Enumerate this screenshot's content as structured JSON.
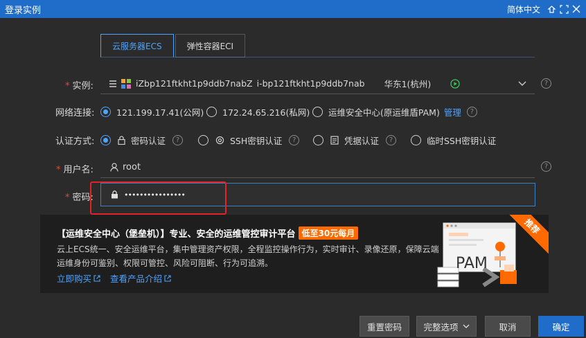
{
  "window": {
    "title": "登录实例",
    "language": "简体中文"
  },
  "tabs": [
    {
      "label": "云服务器ECS"
    },
    {
      "label": "弹性容器ECI"
    }
  ],
  "instance": {
    "label": "实例:",
    "id": "iZbp121ftkht1p9ddb7nabZ",
    "instance_id": "i-bp121ftkht1p9ddb7nab",
    "region": "华东1(杭州)"
  },
  "network": {
    "label": "网络连接:",
    "options": [
      {
        "label": "121.199.17.41(公网)"
      },
      {
        "label": "172.24.65.216(私网)"
      },
      {
        "label": "运维安全中心(原运维盾PAM)"
      }
    ],
    "manage_link": "管理"
  },
  "auth": {
    "label": "认证方式:",
    "options": [
      {
        "label": "密码认证"
      },
      {
        "label": "SSH密钥认证"
      },
      {
        "label": "凭据认证"
      },
      {
        "label": "临时SSH密钥认证"
      }
    ]
  },
  "username": {
    "label": "用户名:",
    "value": "root"
  },
  "password": {
    "label": "密码:",
    "value": "••••••••••••••••"
  },
  "banner": {
    "title": "【运维安全中心（堡垒机）】专业、安全的运维管控审计平台",
    "badge": "低至30元每月",
    "desc": "云上ECS统一、安全运维平台，集中管理资产权限，全程监控操作行为，实时审计、录像还原，保障云端运维身份可鉴别、权限可管控、风险可阻断、行为可追溯。",
    "buy_link": "立即购买",
    "intro_link": "查看产品介绍",
    "corner": "推荐",
    "pam_text": "PAM"
  },
  "buttons": {
    "reset_password": "重置密码",
    "full_options": "完整选项",
    "cancel": "取消",
    "confirm": "确定"
  },
  "colors": {
    "accent": "#1f6cc9",
    "link": "#4ea3ff",
    "required": "#e04a3a",
    "promo": "#ff6a00",
    "highlight": "#e2242a"
  }
}
